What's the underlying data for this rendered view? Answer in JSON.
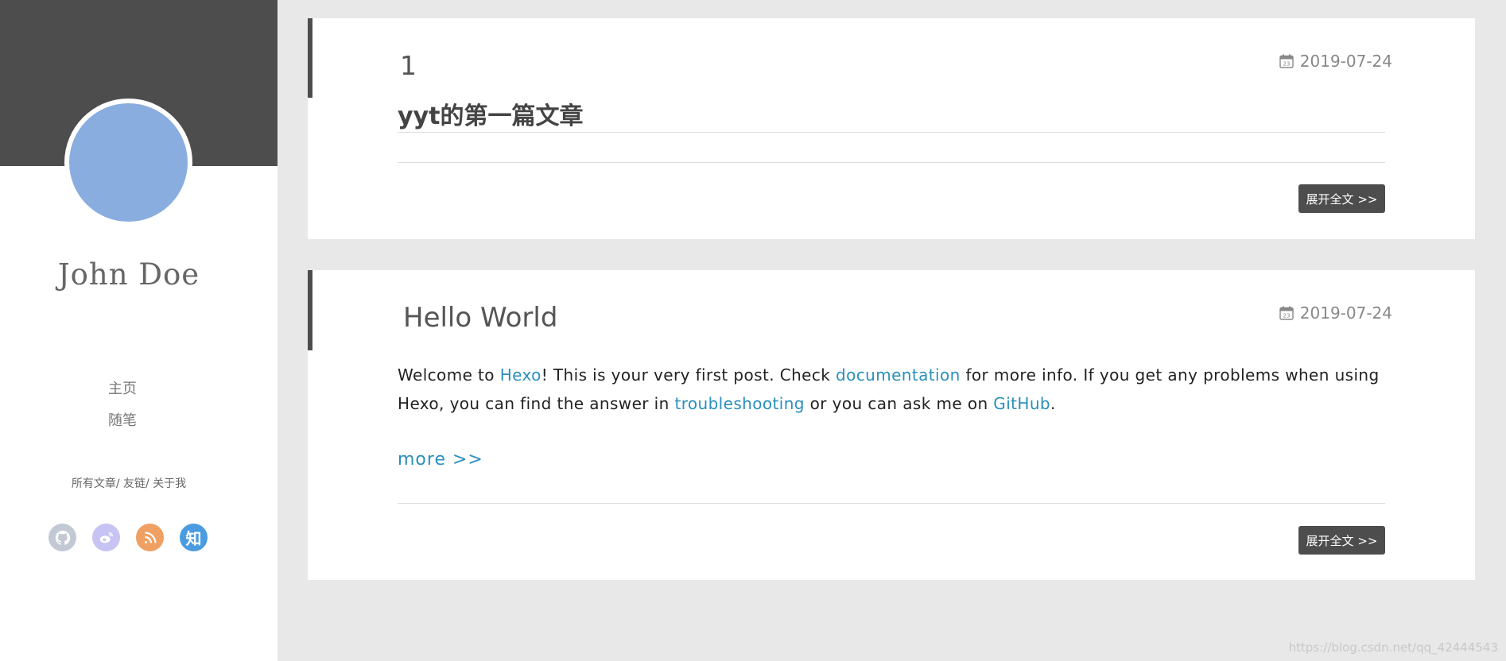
{
  "sidebar": {
    "author_name": "John Doe",
    "nav": [
      "主页",
      "随笔"
    ],
    "sub_nav": [
      "所有文章",
      "友链",
      "关于我"
    ],
    "social": [
      {
        "name": "github",
        "icon": "github-icon",
        "color": "#c3c9d4"
      },
      {
        "name": "weibo",
        "icon": "weibo-icon",
        "color": "#c7c3f2"
      },
      {
        "name": "rss",
        "icon": "rss-icon",
        "color": "#f0a062"
      },
      {
        "name": "zhihu",
        "icon": "zhihu-icon",
        "color": "#4a9be0",
        "glyph": "知"
      }
    ]
  },
  "posts": [
    {
      "number": "1",
      "title": "yyt的第一篇文章",
      "date": "2019-07-24",
      "read_more": "展开全文 >>"
    },
    {
      "title": "Hello World",
      "date": "2019-07-24",
      "excerpt": {
        "t1": "Welcome to ",
        "link1": "Hexo",
        "t2": "! This is your very first post. Check ",
        "link2": "documentation",
        "t3": " for more info. If you get any problems when using Hexo, you can find the answer in ",
        "link3": "troubleshooting",
        "t4": " or you can ask me on ",
        "link4": "GitHub",
        "t5": "."
      },
      "more": "more >>",
      "read_more": "展开全文 >>"
    }
  ],
  "watermark": "https://blog.csdn.net/qq_42444543",
  "colors": {
    "accent_dark": "#4d4d4d",
    "link": "#2a8fbd",
    "avatar": "#8aaddf",
    "background": "#e8e8e8"
  }
}
